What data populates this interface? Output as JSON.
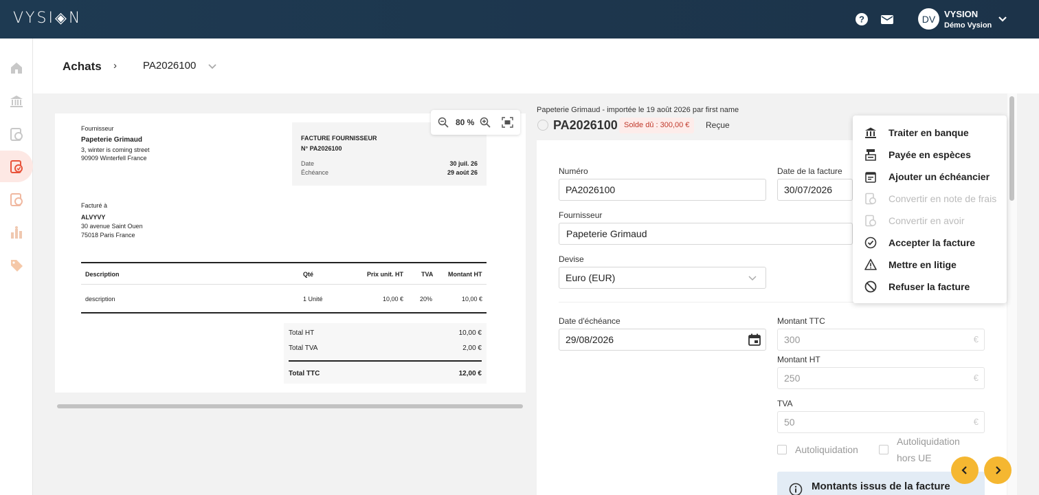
{
  "app": {
    "logo": "VYSI◈N",
    "user": {
      "initials": "DV",
      "name": "VYSION",
      "org": "Démo Vysion"
    }
  },
  "sidebar": {
    "items": [
      {
        "name": "home-icon"
      },
      {
        "name": "bank-icon"
      },
      {
        "name": "sales-icon"
      },
      {
        "name": "purchases-icon",
        "active": true
      },
      {
        "name": "expenses-icon"
      },
      {
        "name": "reports-icon"
      },
      {
        "name": "tag-icon"
      }
    ]
  },
  "header": {
    "breadcrumb_root": "Achats",
    "separator": "›",
    "document": "PA2026100"
  },
  "preview": {
    "zoom": "80 %",
    "supplier_label": "Fournisseur",
    "supplier_name": "Papeterie Grimaud",
    "supplier_addr1": "3, winter is coming street",
    "supplier_addr2": "90909 Winterfell France",
    "doc_type": "FACTURE FOURNISSEUR",
    "doc_number": "N° PA2026100",
    "date_label": "Date",
    "date_value": "30 juil. 26",
    "due_label": "Échéance",
    "due_value": "29 août 26",
    "billed_label": "Facturé à",
    "billed_name": "ALVYVY",
    "billed_addr1": "30 avenue Saint Ouen",
    "billed_addr2": "75018 Paris France",
    "columns": [
      "Description",
      "Qté",
      "Prix unit. HT",
      "TVA",
      "Montant HT"
    ],
    "row": [
      "description",
      "1 Unité",
      "10,00 €",
      "20%",
      "10,00 €"
    ],
    "total_ht_label": "Total HT",
    "total_ht": "10,00 €",
    "total_tva_label": "Total TVA",
    "total_tva": "2,00 €",
    "total_ttc_label": "Total TTC",
    "total_ttc": "12,00 €"
  },
  "detail": {
    "meta": "Papeterie Grimaud - importée le 19 août 2026 par first name",
    "title": "PA2026100",
    "solde": "Solde dû : 300,00 €",
    "status": "Reçue",
    "fields": {
      "numero_label": "Numéro",
      "numero": "PA2026100",
      "date_label": "Date de la facture",
      "date": "30/07/2026",
      "supplier_label": "Fournisseur",
      "supplier": "Papeterie Grimaud",
      "currency_label": "Devise",
      "currency": "Euro (EUR)",
      "due_label": "Date d'échéance",
      "due": "29/08/2026",
      "ttc_label": "Montant TTC",
      "ttc_placeholder": "300",
      "ht_label": "Montant HT",
      "ht_placeholder": "250",
      "tva_label": "TVA",
      "tva_placeholder": "50",
      "euro": "€",
      "autoliq_label": "Autoliquidation",
      "autoliq_hors_label_1": "Autoliquidation",
      "autoliq_hors_label_2": "hors UE",
      "info_title": "Montants issus de la facture"
    }
  },
  "menu": {
    "items": [
      {
        "label": "Traiter en banque",
        "icon": "bank-icon",
        "enabled": true
      },
      {
        "label": "Payée en espèces",
        "icon": "cash-register-icon",
        "enabled": true
      },
      {
        "label": "Ajouter un échéancier",
        "icon": "calendar-icon",
        "enabled": true
      },
      {
        "label": "Convertir en note de frais",
        "icon": "expense-note-icon",
        "enabled": false
      },
      {
        "label": "Convertir en avoir",
        "icon": "credit-note-icon",
        "enabled": false
      },
      {
        "label": "Accepter la facture",
        "icon": "check-circle-icon",
        "enabled": true
      },
      {
        "label": "Mettre en litige",
        "icon": "warning-icon",
        "enabled": true
      },
      {
        "label": "Refuser la facture",
        "icon": "ban-icon",
        "enabled": true
      }
    ]
  },
  "colors": {
    "topbar": "#1e3a52",
    "accent": "#e8533a",
    "nav_button": "#f5b731",
    "badge_text": "#c0392b"
  }
}
